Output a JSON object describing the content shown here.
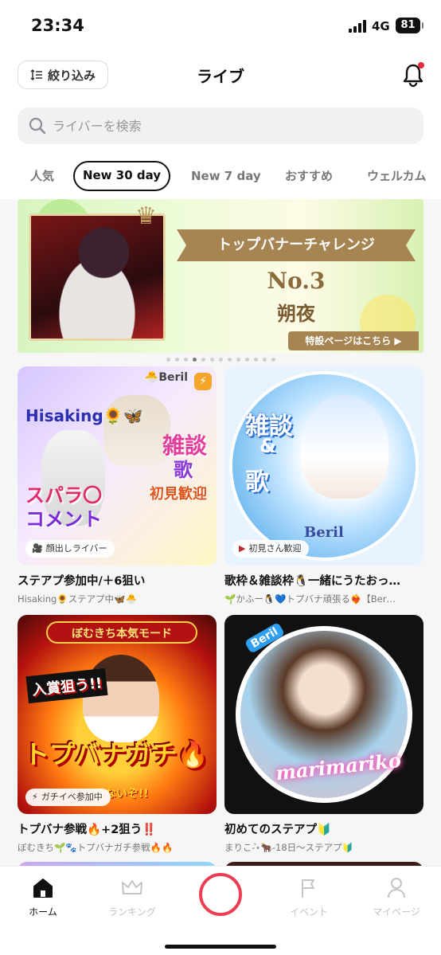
{
  "status_bar": {
    "time": "23:34",
    "network": "4G",
    "battery": "81"
  },
  "header": {
    "filter_label": "絞り込み",
    "title": "ライブ"
  },
  "search": {
    "placeholder": "ライバーを検索"
  },
  "tabs": [
    {
      "label": "人気"
    },
    {
      "label": "New 30 day",
      "active": true
    },
    {
      "label": "New 7 day"
    },
    {
      "label": "おすすめ"
    },
    {
      "label": "ウェルカム"
    }
  ],
  "banner": {
    "ribbon": "トップバナーチャレンジ",
    "rank": "No.3",
    "name": "朔夜",
    "link": "特設ページはこちら ▶",
    "dots_total": 13,
    "dots_active_index": 3
  },
  "cards": [
    {
      "title": "ステアプ参加中/＋6狙い",
      "subtitle": "Hisaking🌻ステアプ中🦋🐣",
      "badge": "顔出しライバー",
      "badge_icon": "camera-icon",
      "art": {
        "name": "Hisaking🌻🦋",
        "logo": "🐣Beril",
        "line1": "雑談",
        "line2": "歌",
        "line3": "初見歓迎",
        "line4": "スパラ〇",
        "line5": "コメント"
      }
    },
    {
      "title": "歌枠＆雑談枠🐧一緒にうたおっ…",
      "subtitle": "🌱かふー🐧💙トプバナ頑張る❤️‍🔥【Ber…",
      "badge": "初見さん歓迎",
      "badge_icon": "flag-icon",
      "art": {
        "word1": "雑談",
        "word2": "&",
        "word3": "歌",
        "logo": "Beril"
      }
    },
    {
      "title": "トプバナ参戦🔥+2狙う‼️",
      "subtitle": "ぼむきち🌱🐾トプバナガチ参戦🔥🔥",
      "badge": "ガチイベ参加中",
      "badge_icon": "lightning-icon",
      "art": {
        "head": "ぼむきち本気モード",
        "left": "入賞狙う!!",
        "big": "トプバナガチ🔥",
        "tail": "めないぞ!!"
      }
    },
    {
      "title": "初めてのステアプ🔰",
      "subtitle": "まりこ-͛⋆🐂-18日〜ステアプ🔰",
      "art": {
        "tag": "Beril",
        "sign": "marimariko"
      }
    }
  ],
  "bottom_nav": [
    {
      "label": "ホーム",
      "icon": "home-icon",
      "active": true
    },
    {
      "label": "ランキング",
      "icon": "crown-icon"
    },
    {
      "label": "",
      "icon": "go-live-icon"
    },
    {
      "label": "イベント",
      "icon": "flag-icon"
    },
    {
      "label": "マイページ",
      "icon": "person-icon"
    }
  ],
  "colors": {
    "accent": "#ec3d52",
    "tab_active_border": "#111111",
    "banner_gold": "#a78552"
  }
}
